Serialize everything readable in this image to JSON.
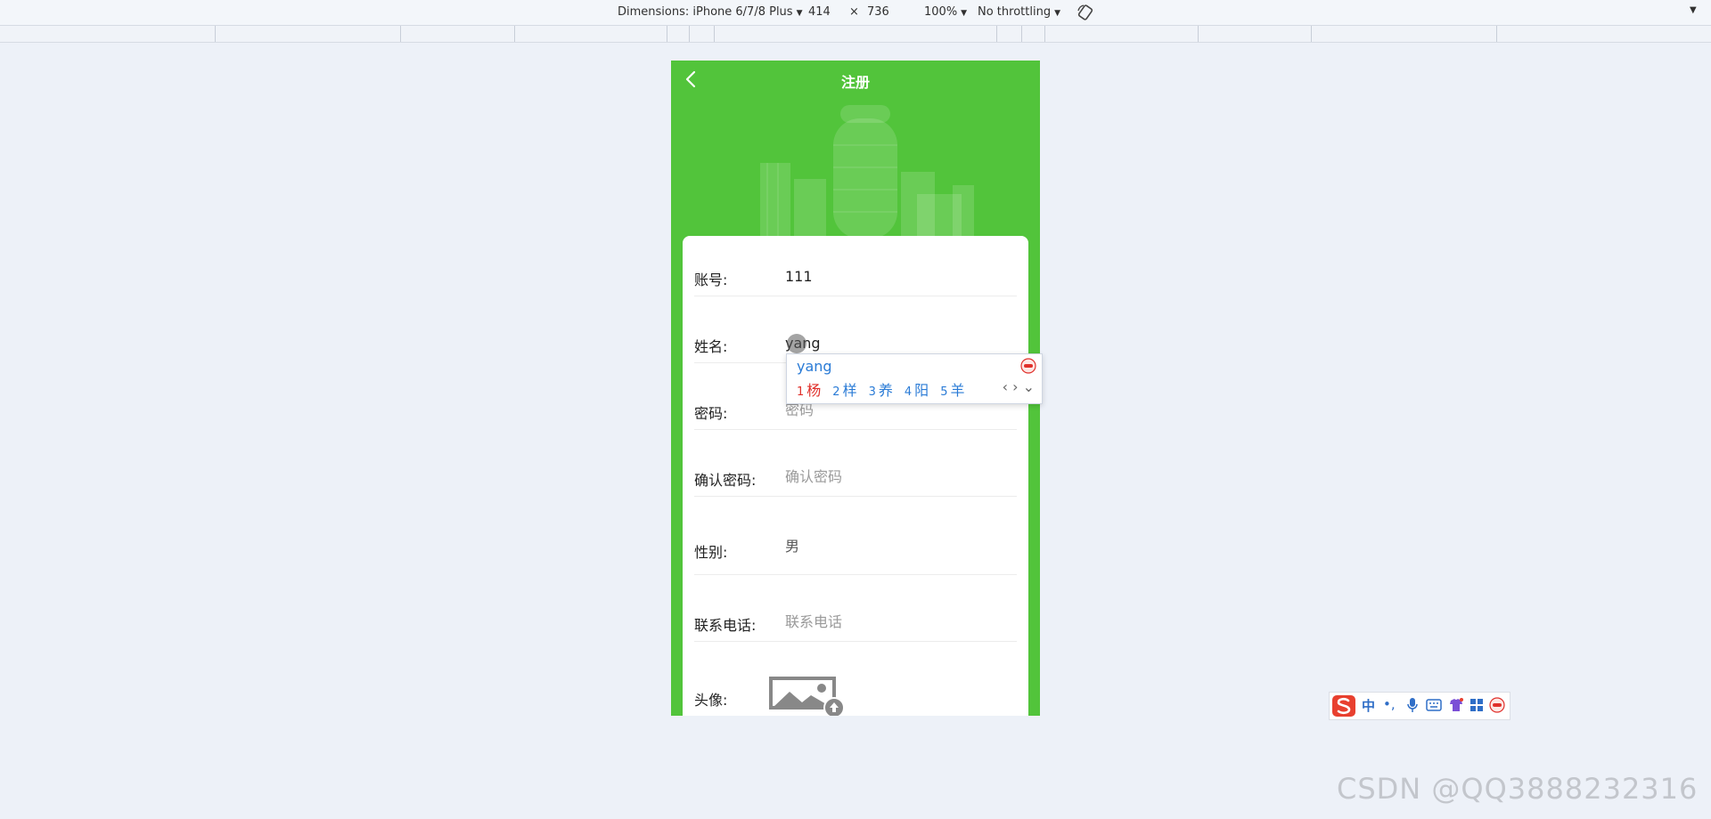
{
  "devtools": {
    "dimensions_label": "Dimensions: iPhone 6/7/8 Plus",
    "width": "414",
    "times": "×",
    "height": "736",
    "zoom": "100%",
    "throttling": "No throttling"
  },
  "page": {
    "title": "注册",
    "fields": [
      {
        "label": "账号:",
        "value": "111",
        "placeholder": ""
      },
      {
        "label": "姓名:",
        "value": "yang",
        "placeholder": ""
      },
      {
        "label": "密码:",
        "value": "",
        "placeholder": "密码"
      },
      {
        "label": "确认密码:",
        "value": "",
        "placeholder": "确认密码"
      },
      {
        "label": "性别:",
        "value": "男",
        "placeholder": ""
      },
      {
        "label": "联系电话:",
        "value": "",
        "placeholder": "联系电话"
      },
      {
        "label": "头像:"
      }
    ]
  },
  "ime": {
    "composition": "yang",
    "candidates": [
      {
        "num": "1",
        "char": "杨"
      },
      {
        "num": "2",
        "char": "样"
      },
      {
        "num": "3",
        "char": "养"
      },
      {
        "num": "4",
        "char": "阳"
      },
      {
        "num": "5",
        "char": "羊"
      }
    ],
    "nav": "‹ › ⌄"
  },
  "sogou_bar": {
    "mode": "中",
    "punct": "•,"
  },
  "watermark": "CSDN @QQ3888232316",
  "colors": {
    "header_green": "#52c43b",
    "ime_blue": "#2a7bd6",
    "ime_first": "#e0302b"
  }
}
